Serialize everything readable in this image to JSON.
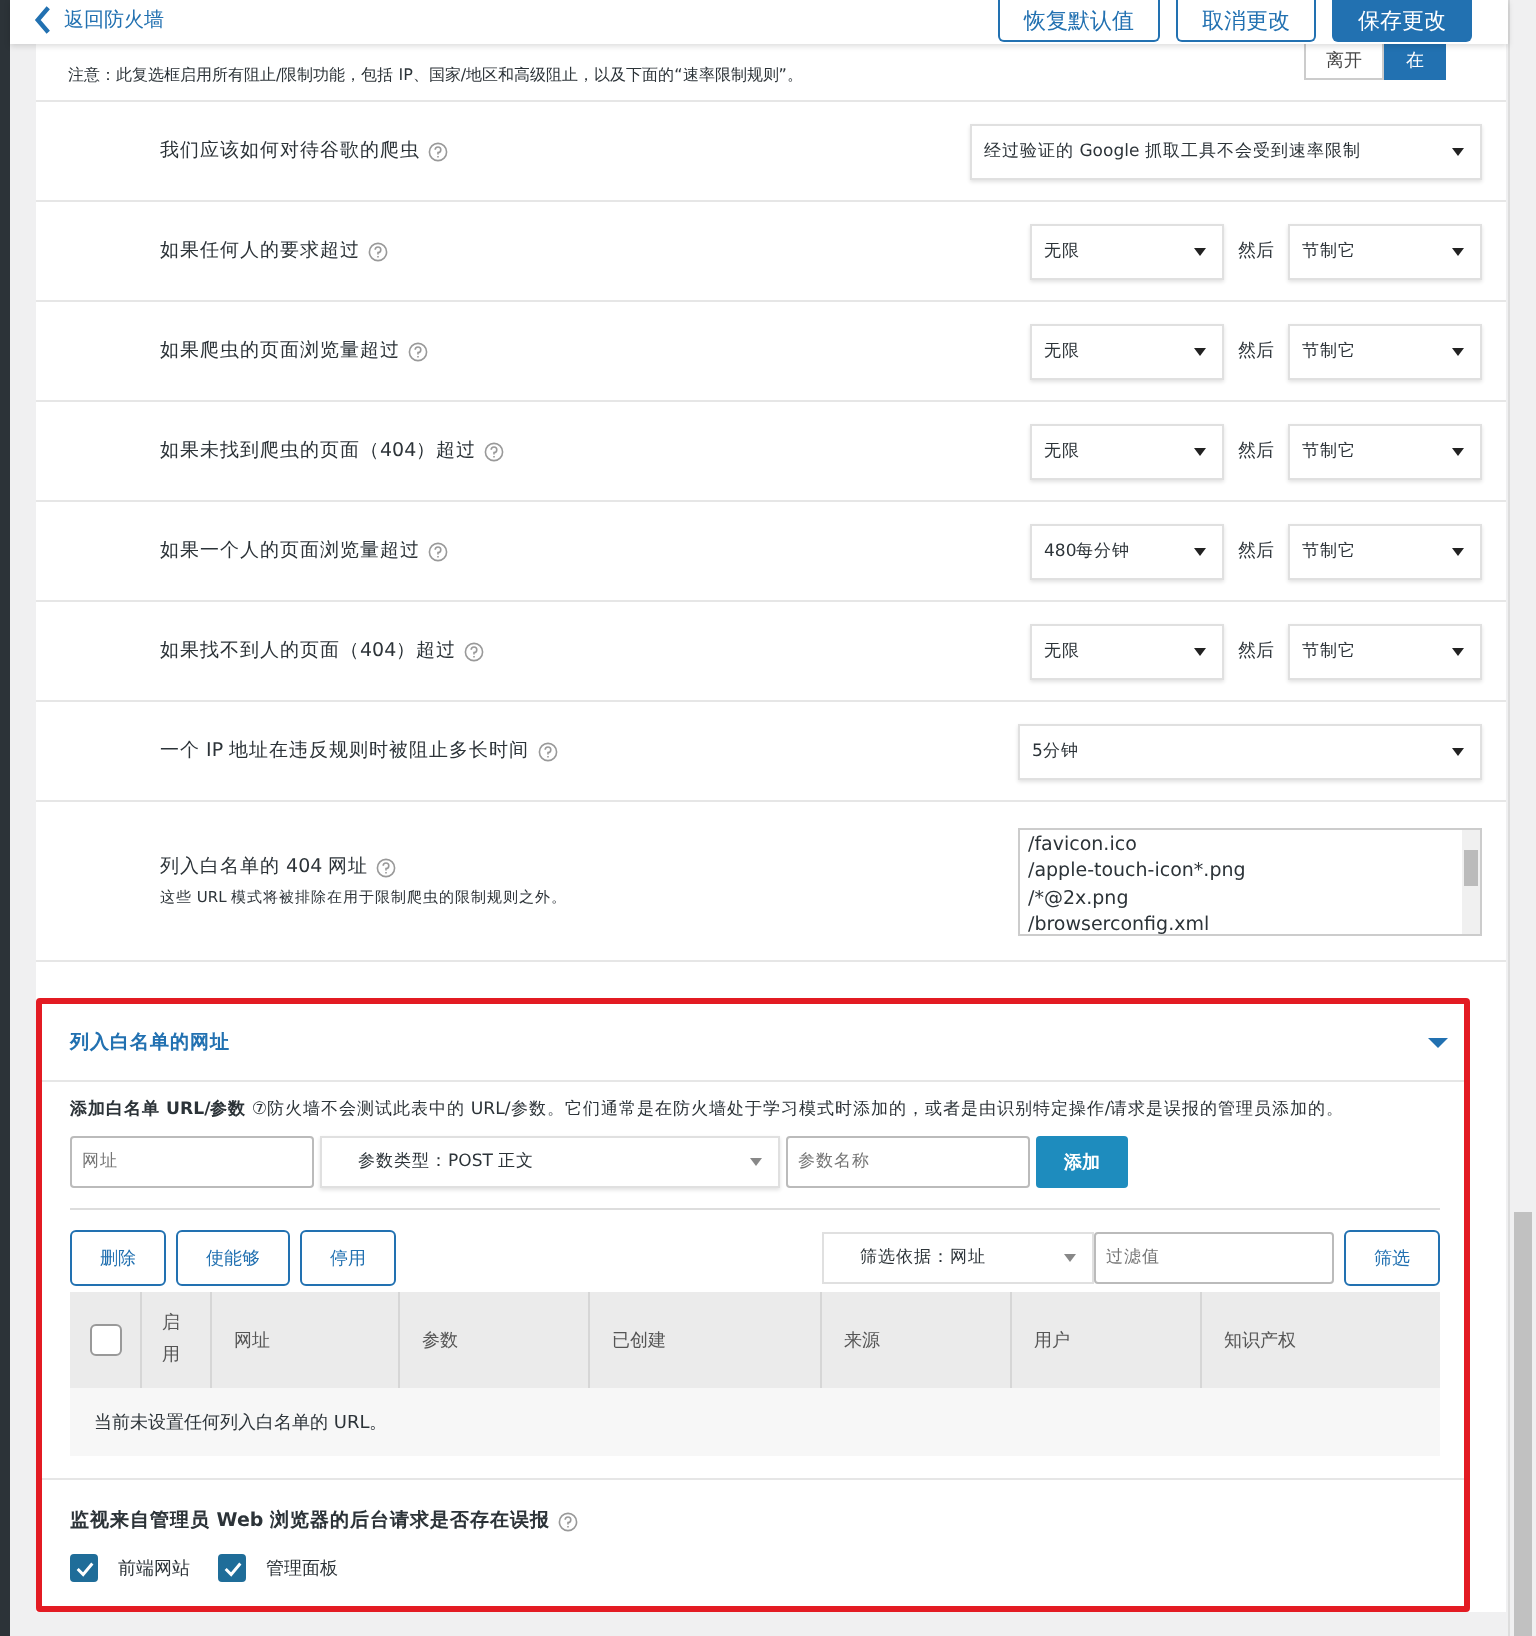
{
  "header": {
    "back_link": "返回防火墙",
    "buttons": [
      {
        "label": "恢复默认值",
        "kind": "secondary"
      },
      {
        "label": "取消更改",
        "kind": "secondary"
      },
      {
        "label": "保存更改",
        "kind": "primary"
      }
    ]
  },
  "notice": {
    "text": "注意：此复选框启用所有阻止/限制功能，包括 IP、国家/地区和高级阻止，以及下面的“速率限制规则”。",
    "toggle": [
      {
        "label": "离开",
        "selected": false
      },
      {
        "label": "在",
        "selected": true
      }
    ]
  },
  "settings": [
    {
      "kind": "single",
      "label": "我们应该如何对待谷歌的爬虫",
      "value": "经过验证的 Google 抓取工具不会受到速率限制"
    },
    {
      "kind": "pair",
      "label": "如果任何人的要求超过",
      "value": "无限",
      "then": "然后",
      "action": "节制它"
    },
    {
      "kind": "pair",
      "label": "如果爬虫的页面浏览量超过",
      "value": "无限",
      "then": "然后",
      "action": "节制它"
    },
    {
      "kind": "pair",
      "label": "如果未找到爬虫的页面（404）超过",
      "value": "无限",
      "then": "然后",
      "action": "节制它"
    },
    {
      "kind": "pair",
      "label": "如果一个人的页面浏览量超过",
      "value": "480每分钟",
      "then": "然后",
      "action": "节制它"
    },
    {
      "kind": "pair",
      "label": "如果找不到人的页面（404）超过",
      "value": "无限",
      "then": "然后",
      "action": "节制它"
    },
    {
      "kind": "single",
      "label": "一个 IP 地址在违反规则时被阻止多长时间",
      "value": "5分钟"
    },
    {
      "kind": "textarea",
      "label": "列入白名单的 404 网址",
      "hint": "这些 URL 模式将被排除在用于限制爬虫的限制规则之外。",
      "lines": [
        "/favicon.ico",
        "/apple-touch-icon*.png",
        "/*@2x.png",
        "/browserconfig.xml"
      ]
    }
  ],
  "whitelist": {
    "title": "列入白名单的网址",
    "expanded": true,
    "intro": "**添加白名单 URL/参数** ⑦防火墙不会测试此表中的 URL/参数。它们通常是在防火墙处于学习模式时添加的，或者是由识别特定操作/请求是误报的管理员添加的。",
    "url_placeholder": "网址",
    "param_type": "参数类型：POST 正文",
    "param_placeholder": "参数名称",
    "add_button": "添加",
    "actions": [
      "删除",
      "使能够",
      "停用"
    ],
    "filter_by": "筛选依据：网址",
    "filter_placeholder": "过滤值",
    "filter_button": "筛选",
    "table": {
      "select_all_checked": false,
      "columns": [
        "启用",
        "网址",
        "参数",
        "已创建",
        "来源",
        "用户",
        "知识产权"
      ],
      "empty": "当前未设置任何列入白名单的 URL。"
    },
    "monitor": {
      "title": "监视来自管理员 Web 浏览器的后台请求是否存在误报",
      "options": [
        {
          "label": "前端网站",
          "checked": true
        },
        {
          "label": "管理面板",
          "checked": true
        }
      ]
    }
  }
}
